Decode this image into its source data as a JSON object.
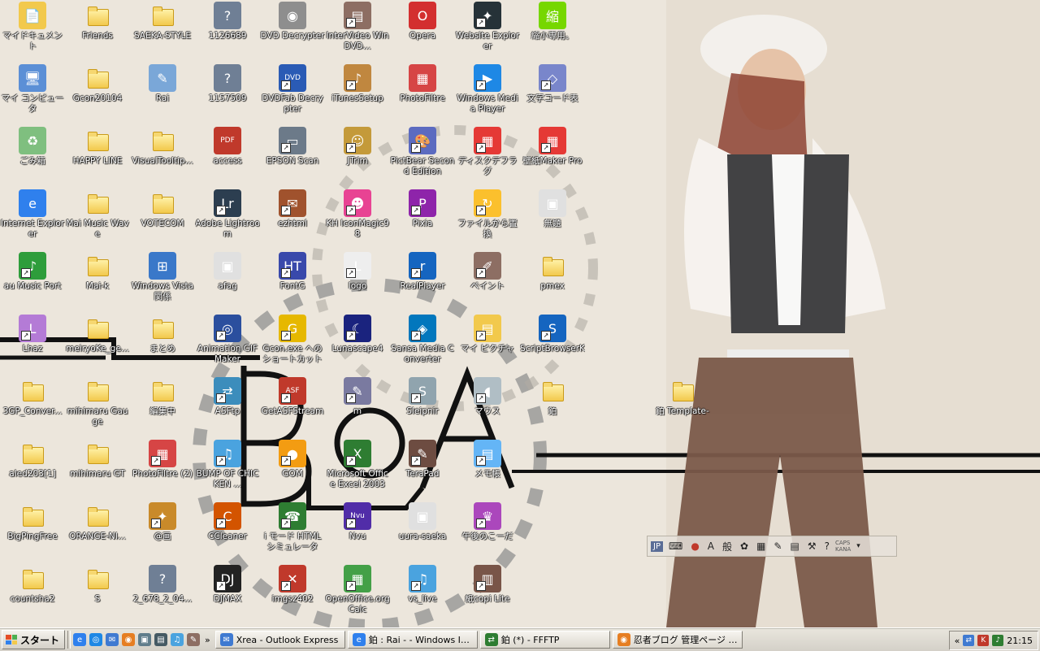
{
  "desktop": {
    "icons": [
      {
        "label": "マイドキュメント",
        "kind": "app",
        "color": "#f2c94c",
        "glyph": "📄",
        "sc": false
      },
      {
        "label": "マイ コンピュータ",
        "kind": "app",
        "color": "#5b8fd6",
        "glyph": "🖥",
        "sc": false
      },
      {
        "label": "ごみ箱",
        "kind": "app",
        "color": "#7fbf7f",
        "glyph": "♻",
        "sc": false
      },
      {
        "label": "Internet Explorer",
        "kind": "app",
        "color": "#2f80ed",
        "glyph": "e",
        "sc": false
      },
      {
        "label": "au Music Port",
        "kind": "app",
        "color": "#2e9d3b",
        "glyph": "♪",
        "sc": true
      },
      {
        "label": "Lhaz",
        "kind": "app",
        "color": "#b47bd6",
        "glyph": "L",
        "sc": true
      },
      {
        "label": "3GP_Conver...",
        "kind": "folder",
        "sc": false
      },
      {
        "label": "aled203[1]",
        "kind": "folder",
        "sc": false
      },
      {
        "label": "BigPingFree",
        "kind": "folder",
        "sc": false
      },
      {
        "label": "countsha2",
        "kind": "folder",
        "sc": false
      },
      {
        "label": "Friends",
        "kind": "folder",
        "sc": false
      },
      {
        "label": "Gcon20104",
        "kind": "folder",
        "sc": false
      },
      {
        "label": "HAPPY LINE",
        "kind": "folder",
        "sc": false
      },
      {
        "label": "Mai Music Wave",
        "kind": "folder",
        "sc": false
      },
      {
        "label": "Mai-k",
        "kind": "folder",
        "sc": false
      },
      {
        "label": "meiryoKe_ge...",
        "kind": "folder",
        "sc": false
      },
      {
        "label": "mihimaru Gauge",
        "kind": "folder",
        "sc": false
      },
      {
        "label": "mihimaru GT",
        "kind": "folder",
        "sc": false
      },
      {
        "label": "ORANGE-NI...",
        "kind": "folder",
        "sc": false
      },
      {
        "label": "S",
        "kind": "folder",
        "sc": false
      },
      {
        "label": "SAEKA-STYLE",
        "kind": "folder",
        "sc": false
      },
      {
        "label": "Rai",
        "kind": "app",
        "color": "#7aa7d8",
        "glyph": "✎",
        "sc": false
      },
      {
        "label": "VisualTooltip...",
        "kind": "folder",
        "sc": false
      },
      {
        "label": "VOTECOM",
        "kind": "folder",
        "sc": false
      },
      {
        "label": "Windows Vista 関係",
        "kind": "app",
        "color": "#3a78c9",
        "glyph": "⊞",
        "sc": false
      },
      {
        "label": "まとめ",
        "kind": "folder",
        "sc": false
      },
      {
        "label": "編集中",
        "kind": "folder",
        "sc": false
      },
      {
        "label": "PhotoFiltre (2)",
        "kind": "app",
        "color": "#d64545",
        "glyph": "▦",
        "sc": true
      },
      {
        "label": "@画",
        "kind": "app",
        "color": "#c98a2a",
        "glyph": "✦",
        "sc": true
      },
      {
        "label": "2_678_2_04...",
        "kind": "app",
        "color": "#6f7f95",
        "glyph": "?",
        "sc": false
      },
      {
        "label": "1126689",
        "kind": "app",
        "color": "#6f7f95",
        "glyph": "?",
        "sc": false
      },
      {
        "label": "1157509",
        "kind": "app",
        "color": "#6f7f95",
        "glyph": "?",
        "sc": false
      },
      {
        "label": "access",
        "kind": "app",
        "color": "#c0392b",
        "glyph": "PDF",
        "sc": false
      },
      {
        "label": "Adobe Lightroom",
        "kind": "app",
        "color": "#2c3e50",
        "glyph": "Lr",
        "sc": true
      },
      {
        "label": "afag",
        "kind": "app",
        "color": "#e0e0e0",
        "glyph": "▣",
        "sc": false
      },
      {
        "label": "Animation GIF Maker",
        "kind": "app",
        "color": "#2b4f9e",
        "glyph": "◎",
        "sc": true
      },
      {
        "label": "ASFtp",
        "kind": "app",
        "color": "#3c8dbc",
        "glyph": "⇄",
        "sc": true
      },
      {
        "label": "BUMP OF CHICKEN ...",
        "kind": "app",
        "color": "#4aa3df",
        "glyph": "♫",
        "sc": true
      },
      {
        "label": "CCleaner",
        "kind": "app",
        "color": "#d35400",
        "glyph": "C",
        "sc": true
      },
      {
        "label": "DJMAX",
        "kind": "app",
        "color": "#222222",
        "glyph": "DJ",
        "sc": true
      },
      {
        "label": "DVD Decrypter",
        "kind": "app",
        "color": "#8e8e8e",
        "glyph": "◉",
        "sc": false
      },
      {
        "label": "DVDFab Decrypter",
        "kind": "app",
        "color": "#2a5bb5",
        "glyph": "DVD",
        "sc": true
      },
      {
        "label": "EPSON Scan",
        "kind": "app",
        "color": "#6c7a89",
        "glyph": "▭",
        "sc": true
      },
      {
        "label": "ezhtml",
        "kind": "app",
        "color": "#a0522d",
        "glyph": "✉",
        "sc": true
      },
      {
        "label": "FontG",
        "kind": "app",
        "color": "#3949ab",
        "glyph": "HT",
        "sc": true
      },
      {
        "label": "Gcon.exe へのショートカット",
        "kind": "app",
        "color": "#e6b800",
        "glyph": "G",
        "sc": true
      },
      {
        "label": "GetASFStream",
        "kind": "app",
        "color": "#c0392b",
        "glyph": "ASF",
        "sc": true
      },
      {
        "label": "GOM",
        "kind": "app",
        "color": "#f39c12",
        "glyph": "●",
        "sc": true
      },
      {
        "label": "i モード HTML シミュレータ",
        "kind": "app",
        "color": "#2e7d32",
        "glyph": "☎",
        "sc": true
      },
      {
        "label": "imgsz402",
        "kind": "app",
        "color": "#c0392b",
        "glyph": "✕",
        "sc": true
      },
      {
        "label": "InterVideo WinDVD...",
        "kind": "app",
        "color": "#8d6e63",
        "glyph": "▤",
        "sc": true
      },
      {
        "label": "iTunesSetup",
        "kind": "app",
        "color": "#c0873f",
        "glyph": "♪",
        "sc": true
      },
      {
        "label": "JTrim",
        "kind": "app",
        "color": "#c49a3a",
        "glyph": "☺",
        "sc": true
      },
      {
        "label": "KH IconMagic98",
        "kind": "app",
        "color": "#e84393",
        "glyph": "☻",
        "sc": true
      },
      {
        "label": "logo",
        "kind": "app",
        "color": "#eeeeee",
        "glyph": "L",
        "sc": true
      },
      {
        "label": "Lunascape4",
        "kind": "app",
        "color": "#1a237e",
        "glyph": "☾",
        "sc": true
      },
      {
        "label": "m",
        "kind": "app",
        "color": "#7a7aa0",
        "glyph": "✎",
        "sc": true
      },
      {
        "label": "Microsoft Office Excel 2003",
        "kind": "app",
        "color": "#2e7d32",
        "glyph": "X",
        "sc": true
      },
      {
        "label": "Nvu",
        "kind": "app",
        "color": "#512da8",
        "glyph": "Nvu",
        "sc": true
      },
      {
        "label": "OpenOffice.org Calc",
        "kind": "app",
        "color": "#43a047",
        "glyph": "▦",
        "sc": true
      },
      {
        "label": "Opera",
        "kind": "app",
        "color": "#d32f2f",
        "glyph": "O",
        "sc": false
      },
      {
        "label": "PhotoFiltre",
        "kind": "app",
        "color": "#d64545",
        "glyph": "▦",
        "sc": false
      },
      {
        "label": "PictBear Second Edition",
        "kind": "app",
        "color": "#5c6bc0",
        "glyph": "🎨",
        "sc": true
      },
      {
        "label": "Pixia",
        "kind": "app",
        "color": "#8e24aa",
        "glyph": "P",
        "sc": true
      },
      {
        "label": "RealPlayer",
        "kind": "app",
        "color": "#1565c0",
        "glyph": "r",
        "sc": true
      },
      {
        "label": "Sansa Media Converter",
        "kind": "app",
        "color": "#0277bd",
        "glyph": "◈",
        "sc": true
      },
      {
        "label": "Sleipnir",
        "kind": "app",
        "color": "#90a4ae",
        "glyph": "S",
        "sc": true
      },
      {
        "label": "TeraPad",
        "kind": "app",
        "color": "#6d4c41",
        "glyph": "✎",
        "sc": true
      },
      {
        "label": "uura-saeka",
        "kind": "app",
        "color": "#e0e0e0",
        "glyph": "▣",
        "sc": false
      },
      {
        "label": "vs_live",
        "kind": "app",
        "color": "#4aa3df",
        "glyph": "♫",
        "sc": true
      },
      {
        "label": "Website Explorer",
        "kind": "app",
        "color": "#263238",
        "glyph": "✦",
        "sc": true
      },
      {
        "label": "Windows Media Player",
        "kind": "app",
        "color": "#1e88e5",
        "glyph": "▶",
        "sc": true
      },
      {
        "label": "ディスクデフラグ",
        "kind": "app",
        "color": "#e53935",
        "glyph": "▦",
        "sc": true
      },
      {
        "label": "ファイルから置換",
        "kind": "app",
        "color": "#fbc02d",
        "glyph": "↻",
        "sc": true
      },
      {
        "label": "ペイント",
        "kind": "app",
        "color": "#8d6e63",
        "glyph": "✐",
        "sc": true
      },
      {
        "label": "マイ ピクチャ",
        "kind": "app",
        "color": "#f2c94c",
        "glyph": "▤",
        "sc": true
      },
      {
        "label": "マウス",
        "kind": "app",
        "color": "#b0bec5",
        "glyph": "◖",
        "sc": true
      },
      {
        "label": "メモ帳",
        "kind": "app",
        "color": "#64b5f6",
        "glyph": "▤",
        "sc": true
      },
      {
        "label": "午後のこーだ",
        "kind": "app",
        "color": "#ab47bc",
        "glyph": "♛",
        "sc": true
      },
      {
        "label": "紙copi Lite",
        "kind": "app",
        "color": "#795548",
        "glyph": "▥",
        "sc": true
      },
      {
        "label": "縮小専用。",
        "kind": "app",
        "color": "#76d700",
        "glyph": "縮",
        "sc": false
      },
      {
        "label": "文字コード表",
        "kind": "app",
        "color": "#7986cb",
        "glyph": "◇",
        "sc": true
      },
      {
        "label": "壁紙Maker Pro",
        "kind": "app",
        "color": "#e53935",
        "glyph": "▦",
        "sc": true
      },
      {
        "label": "無題",
        "kind": "app",
        "color": "#e0e0e0",
        "glyph": "▣",
        "sc": false
      },
      {
        "label": "pmex",
        "kind": "folder",
        "sc": false
      },
      {
        "label": "ScriptBrowserK",
        "kind": "app",
        "color": "#1565c0",
        "glyph": "S",
        "sc": true
      },
      {
        "label": "鉑",
        "kind": "folder",
        "sc": false
      },
      {
        "label": "鉑 Template-",
        "kind": "folder",
        "sc": false
      }
    ]
  },
  "langbar": {
    "lang": "JP",
    "mode": "般",
    "ime_char": "A",
    "caps": "CAPS",
    "kana": "KANA"
  },
  "taskbar": {
    "start_label": "スタート",
    "chevron": "»",
    "tasks": [
      {
        "label": "Xrea - Outlook Express",
        "color": "#3f7ad1",
        "glyph": "✉"
      },
      {
        "label": "鉑 : Rai - - Windows In...",
        "color": "#2f80ed",
        "glyph": "e"
      },
      {
        "label": "鉑 (*) - FFFTP",
        "color": "#2e7d32",
        "glyph": "⇄"
      },
      {
        "label": "忍者ブログ 管理ページ - ...",
        "color": "#e67e22",
        "glyph": "◉"
      }
    ],
    "tray_chevron": "«",
    "clock": "21:15"
  }
}
